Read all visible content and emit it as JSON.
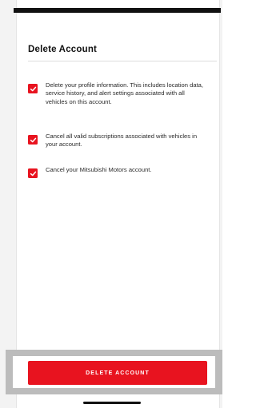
{
  "page": {
    "title": "Delete Account",
    "accent_color": "#e8131f"
  },
  "checklist": [
    {
      "label": "Delete your profile information. This includes location data, service history, and alert settings associated with all vehicles on this account.",
      "checked": true,
      "icon": "checkmark-icon"
    },
    {
      "label": "Cancel all valid subscriptions associated with vehicles in your account.",
      "checked": true,
      "icon": "checkmark-icon"
    },
    {
      "label": "Cancel your Mitsubishi Motors account.",
      "checked": true,
      "icon": "checkmark-icon"
    }
  ],
  "footer": {
    "delete_button_label": "DELETE ACCOUNT"
  }
}
